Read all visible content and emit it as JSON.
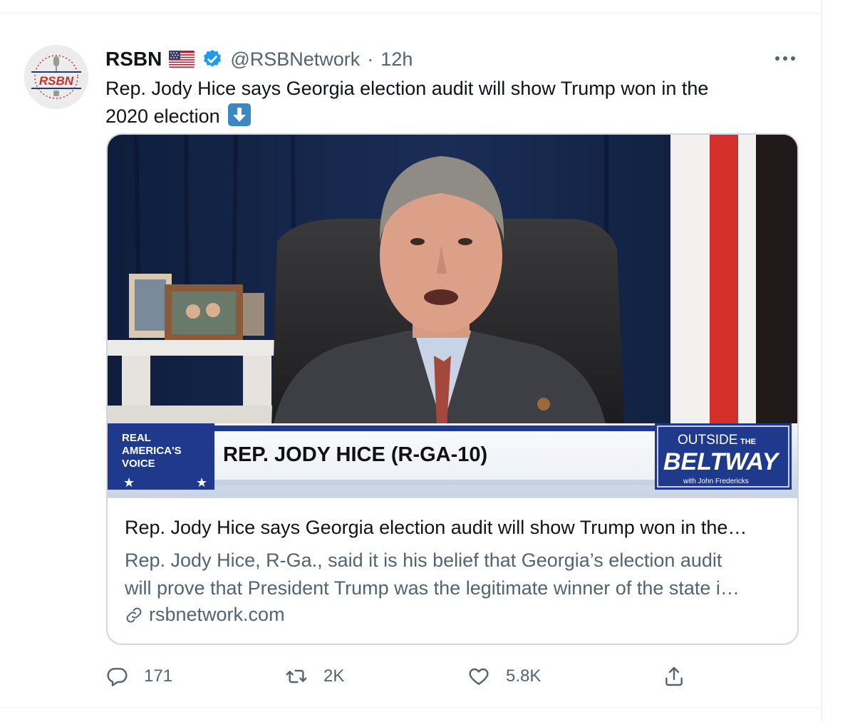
{
  "tweet": {
    "display_name": "RSBN",
    "handle": "@RSBNetwork",
    "separator": "·",
    "time": "12h",
    "text_line1": "Rep. Jody Hice says Georgia election audit will show Trump won in the",
    "text_line2": "2020 election",
    "flag_icon": "us-flag-icon",
    "verified_icon": "verified-badge-icon",
    "down_arrow_emoji": "down-arrow-emoji"
  },
  "avatar": {
    "logo_text": "RSBN"
  },
  "card": {
    "image": {
      "lower_third_name": "REP. JODY HICE (R-GA-10)",
      "network_logo_line1": "REAL",
      "network_logo_line2": "AMERICA'S",
      "network_logo_line3": "VOICE",
      "show_logo_top": "OUTSIDE",
      "show_logo_the": "THE",
      "show_logo_main": "BELTWAY",
      "show_logo_sub": "with John Fredericks"
    },
    "title": "Rep. Jody Hice says Georgia election audit will show Trump won in the…",
    "description_line1": "Rep. Jody Hice, R-Ga., said it is his belief that Georgia’s election audit",
    "description_line2": "will prove that President Trump was the legitimate winner of the state i…",
    "domain": "rsbnetwork.com"
  },
  "actions": {
    "reply_count": "171",
    "retweet_count": "2K",
    "like_count": "5.8K"
  },
  "colors": {
    "text_primary": "#0f1419",
    "text_secondary": "#536471",
    "border": "#cfd9de",
    "verified_blue": "#1d9bf0",
    "emoji_blue": "#3b88c3"
  }
}
